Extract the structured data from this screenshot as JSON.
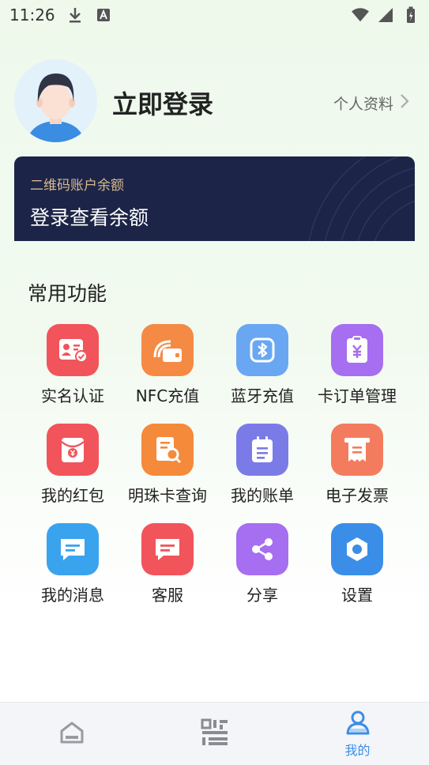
{
  "status_bar": {
    "time": "11:26"
  },
  "profile": {
    "login_text": "立即登录",
    "profile_link": "个人资料"
  },
  "balance": {
    "label": "二维码账户余额",
    "value": "登录查看余额"
  },
  "section": {
    "title": "常用功能"
  },
  "functions": [
    {
      "label": "实名认证",
      "icon": "id-card-icon",
      "color": "#f2545b"
    },
    {
      "label": "NFC充值",
      "icon": "nfc-card-icon",
      "color": "#f58a45"
    },
    {
      "label": "蓝牙充值",
      "icon": "bluetooth-icon",
      "color": "#6aa7f2"
    },
    {
      "label": "卡订单管理",
      "icon": "yen-order-icon",
      "color": "#a66ef0"
    },
    {
      "label": "我的红包",
      "icon": "red-envelope-icon",
      "color": "#f2545b"
    },
    {
      "label": "明珠卡查询",
      "icon": "card-search-icon",
      "color": "#f58a3a"
    },
    {
      "label": "我的账单",
      "icon": "bill-icon",
      "color": "#7b7be8"
    },
    {
      "label": "电子发票",
      "icon": "invoice-icon",
      "color": "#f47c5e"
    },
    {
      "label": "我的消息",
      "icon": "message-icon",
      "color": "#3aa3ee"
    },
    {
      "label": "客服",
      "icon": "customer-service-icon",
      "color": "#f2545b"
    },
    {
      "label": "分享",
      "icon": "share-icon",
      "color": "#a66ef0"
    },
    {
      "label": "设置",
      "icon": "settings-icon",
      "color": "#3a8ee8"
    }
  ],
  "tabbar": {
    "items": [
      {
        "icon": "home-icon",
        "label": ""
      },
      {
        "icon": "qrcode-icon",
        "label": ""
      },
      {
        "icon": "user-icon",
        "label": "我的"
      }
    ],
    "active_color": "#3a8ee8"
  }
}
